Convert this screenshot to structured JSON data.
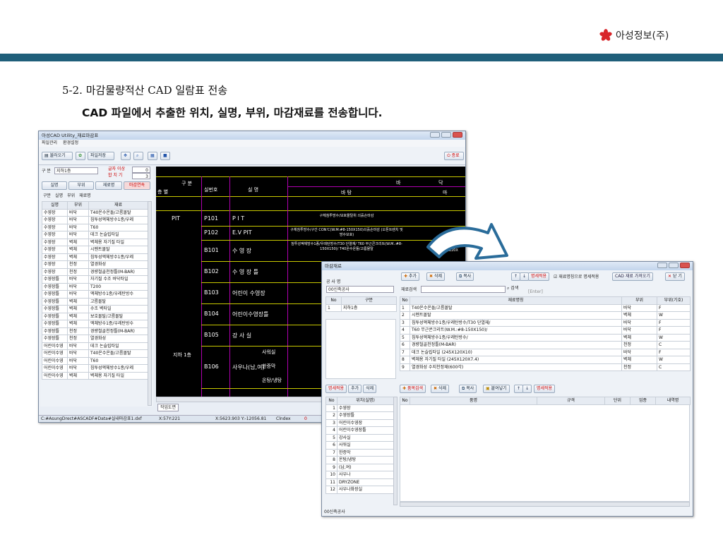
{
  "brand": {
    "logo_text": "아성정보(주)",
    "accent_color": "#d8252a",
    "band_color": "#1f5f7a"
  },
  "heading": "5-2. 마감물량적산 CAD 일람표 전송",
  "subheading": "CAD 파일에서 추출한 위치, 실명, 부위, 마감재료를 전송합니다.",
  "main_window": {
    "title": "아성CAD Utility_재료마감표",
    "menu": [
      "파일관리",
      "환경설정"
    ],
    "toolbar": {
      "open": "불러오기",
      "save": "파일저장",
      "close": "종료"
    },
    "floor_label": "구 분",
    "floor_value": "지하1층",
    "count_label1": "글자 이상",
    "count_value1": "0",
    "count_label2": "합 치 기",
    "count_value2": "3",
    "filter_tabs": [
      "실명",
      "부위",
      "재료명",
      "마감연속"
    ],
    "list_tabs": [
      "구분",
      "실명",
      "부위",
      "재료명"
    ],
    "headers": [
      "실명",
      "부위",
      "재료"
    ],
    "rows": [
      [
        "수영장",
        "바닥",
        "T40온수온돌/고름몰탈"
      ],
      [
        "수영장",
        "바닥",
        "침투성액체방수1종/우레"
      ],
      [
        "수영장",
        "바닥",
        "T60"
      ],
      [
        "수영장",
        "바닥",
        "데크 논슬립타일"
      ],
      [
        "수영장",
        "벽체",
        "벽체용 자기질 타일"
      ],
      [
        "수영장",
        "벽체",
        "시멘트몰탈"
      ],
      [
        "수영장",
        "벽체",
        "침투성액체방수1종/우레"
      ],
      [
        "수영장",
        "천정",
        "열경화성"
      ],
      [
        "수영장",
        "천정",
        "경량철골천정틀(M-BAR)"
      ],
      [
        "수영장틀",
        "바닥",
        "자기질 수조 바닥타일"
      ],
      [
        "수영장틀",
        "바닥",
        "T200"
      ],
      [
        "수영장틀",
        "바닥",
        "액체방수1종/우레탄방수"
      ],
      [
        "수영장틀",
        "벽체",
        "고름몰탈"
      ],
      [
        "수영장틀",
        "벽체",
        "수조 벽타일"
      ],
      [
        "수영장틀",
        "벽체",
        "보호몰탈/고름몰탈"
      ],
      [
        "수영장틀",
        "벽체",
        "액체방수1종/우레탄방수"
      ],
      [
        "수영장틀",
        "천정",
        "경량철골천정틀(M-BAR)"
      ],
      [
        "수영장틀",
        "천정",
        "열경화성"
      ],
      [
        "어린이수영",
        "바닥",
        "데크 논슬립타일"
      ],
      [
        "어린이수영",
        "바닥",
        "T40온수온돌/고름몰탈"
      ],
      [
        "어린이수영",
        "바닥",
        "T60"
      ],
      [
        "어린이수영",
        "바닥",
        "침투성액체방수1종/우레"
      ],
      [
        "어린이수영",
        "벽체",
        "벽체용 자기질 타일"
      ]
    ],
    "layout_tab": "작업도면",
    "status": {
      "path": "C:#AsungDrect#ASCADF#Data#실내마감표1.dxf",
      "coord1": "X:57Y:221",
      "coord2": "X:5623.903  Y:-12056.81",
      "mode": "Clndex",
      "value": "0"
    }
  },
  "cad": {
    "header_top": "구 분",
    "header_sub": "층 별",
    "room_no": "실번호",
    "room_name": "실 명",
    "col_b": "바",
    "col_dak": "닥",
    "finish": "바 탕",
    "col_ma": "마",
    "floor": "지하 1층",
    "rooms": [
      {
        "no": "P101",
        "name": "P I T",
        "pit": "PIT",
        "spec": "구체침투방수/보호몰탈위 쇠흙손마감"
      },
      {
        "no": "P102",
        "name": "E.V PIT",
        "pit": "",
        "spec": "구체침투방수/구간 CON'C(W.M:#8-150X150)쇠흙손마감 (오톤트렌치 및 방수보호)"
      },
      {
        "no": "B101",
        "name": "수 영 장",
        "spec": "침투성액체방수1종/우레탄방수/T30 단열재/ T60 무근콘크리트(W.M.:#8-150X150)/ T40온수온돌/고름몰탈",
        "right": "(245X120X"
      },
      {
        "no": "B102",
        "name": "수 영 장 틀",
        "spec": "T200 무근"
      },
      {
        "no": "B103",
        "name": "어린이 수영장",
        "spec": "T60 무근"
      },
      {
        "no": "B104",
        "name": "어린이수영장틀",
        "spec": "T200 무근"
      },
      {
        "no": "B105",
        "name": "강 사 실",
        "spec": "T60 무근"
      },
      {
        "no": "B106",
        "name": "사우나(남,여)",
        "sub": [
          "사워실",
          "한증막",
          "온탕/냉탕"
        ]
      }
    ]
  },
  "dialog": {
    "title": "마감재료",
    "space_label": "공 사 명",
    "space_value": "00신축공사",
    "left_headers": [
      "No",
      "구분"
    ],
    "left_rows": [
      [
        "1",
        "지하1층"
      ]
    ],
    "material_search_label": "재료검색",
    "search_btn": "검색",
    "enter_hint": "[Enter]",
    "top_buttons": [
      "추가",
      "삭제",
      "복사",
      "명세적용",
      "재료명칭으로 명세적용",
      "CAD 재료 가져오기",
      "닫 기"
    ],
    "mat_headers": [
      "No",
      "재료명칭",
      "부위",
      "부위(기호)"
    ],
    "mat_rows": [
      [
        "1",
        "T40온수온돌/고름몰탈",
        "바닥",
        "F"
      ],
      [
        "2",
        "시멘트몰탈",
        "벽체",
        "W"
      ],
      [
        "3",
        "침투성액체방수1종/우레탄방수/T30 단열재/",
        "바닥",
        "F"
      ],
      [
        "4",
        "T60 무근콘크리트(W.M.:#8-150X150)/",
        "바닥",
        "F"
      ],
      [
        "5",
        "침투성액체방수1종/우레탄방수/",
        "벽체",
        "W"
      ],
      [
        "6",
        "경량철골천정틀(M-BAR)",
        "천정",
        "C"
      ],
      [
        "7",
        "데크 논슬립타일 (245X120X10)",
        "바닥",
        "F"
      ],
      [
        "8",
        "벽체용 자기질 타일 (245X120X7.4)",
        "벽체",
        "W"
      ],
      [
        "9",
        "열경화성 수지천정재(600각)",
        "천정",
        "C"
      ]
    ],
    "bottom_left_buttons": [
      "명세적용",
      "추가",
      "삭제"
    ],
    "bottom_right_buttons": [
      "품목검색",
      "삭제",
      "복사",
      "붙여넣기",
      "명세적용"
    ],
    "loc_headers": [
      "No",
      "위치(실명)"
    ],
    "loc_rows": [
      [
        "1",
        "수영장"
      ],
      [
        "2",
        "수영장틀"
      ],
      [
        "3",
        "어린이수영장"
      ],
      [
        "4",
        "어린이수영장틀"
      ],
      [
        "5",
        "강사실"
      ],
      [
        "6",
        "사워실"
      ],
      [
        "7",
        "한증막"
      ],
      [
        "8",
        "온탕/냉탕"
      ],
      [
        "9",
        "(남,여)"
      ],
      [
        "10",
        "사우나"
      ],
      [
        "11",
        "DRYZONE"
      ],
      [
        "12",
        "사우나화장실"
      ]
    ],
    "item_headers": [
      "No",
      "품명",
      "규격",
      "단위",
      "업종",
      "내역명"
    ],
    "status": "00신축공사"
  }
}
